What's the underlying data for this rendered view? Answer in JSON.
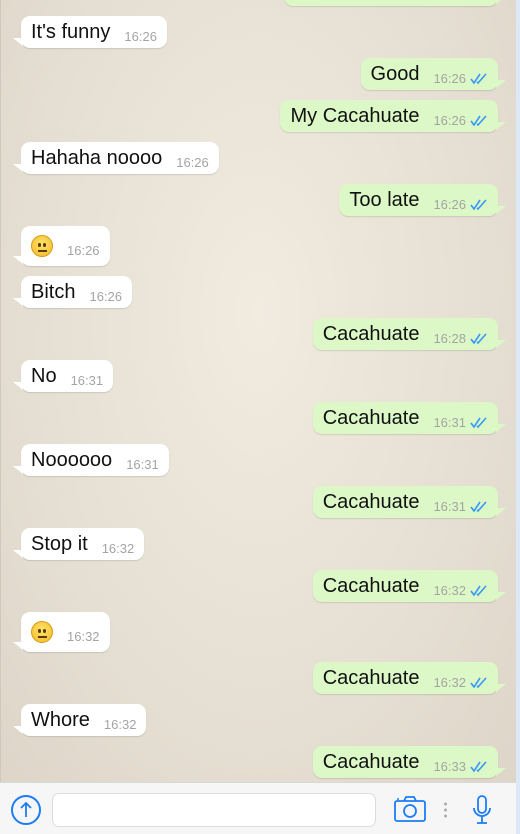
{
  "colors": {
    "outgoing": "#dcf8c6",
    "incoming": "#ffffff",
    "tick": "#3497f9",
    "accent": "#1c7cf4"
  },
  "messages": [
    {
      "dir": "out",
      "text": "",
      "time": "",
      "read": true,
      "partial": true
    },
    {
      "dir": "in",
      "text": "It's funny",
      "time": "16:26"
    },
    {
      "dir": "out",
      "text": "Good",
      "time": "16:26",
      "read": true
    },
    {
      "dir": "out",
      "text": "My Cacahuate",
      "time": "16:26",
      "read": true
    },
    {
      "dir": "in",
      "text": "Hahaha noooo",
      "time": "16:26"
    },
    {
      "dir": "out",
      "text": "Too late",
      "time": "16:26",
      "read": true
    },
    {
      "dir": "in",
      "emoji": "neutral-face",
      "time": "16:26"
    },
    {
      "dir": "in",
      "text": "Bitch",
      "time": "16:26"
    },
    {
      "dir": "out",
      "text": "Cacahuate",
      "time": "16:28",
      "read": true
    },
    {
      "dir": "in",
      "text": "No",
      "time": "16:31"
    },
    {
      "dir": "out",
      "text": "Cacahuate",
      "time": "16:31",
      "read": true
    },
    {
      "dir": "in",
      "text": "Noooooo",
      "time": "16:31"
    },
    {
      "dir": "out",
      "text": "Cacahuate",
      "time": "16:31",
      "read": true
    },
    {
      "dir": "in",
      "text": "Stop it",
      "time": "16:32"
    },
    {
      "dir": "out",
      "text": "Cacahuate",
      "time": "16:32",
      "read": true
    },
    {
      "dir": "in",
      "emoji": "neutral-face",
      "time": "16:32"
    },
    {
      "dir": "out",
      "text": "Cacahuate",
      "time": "16:32",
      "read": true
    },
    {
      "dir": "in",
      "text": "Whore",
      "time": "16:32"
    },
    {
      "dir": "out",
      "text": "Cacahuate",
      "time": "16:33",
      "read": true
    }
  ],
  "composer": {
    "input_value": "",
    "icons": [
      "upload-arrow-icon",
      "camera-icon",
      "more-dots-icon",
      "microphone-icon"
    ]
  }
}
